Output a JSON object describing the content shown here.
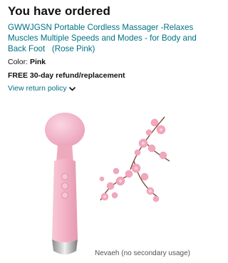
{
  "header": {
    "title": "You have ordered"
  },
  "product": {
    "name": "GWWJGSN Portable Cordless Massager -Relaxes Muscles Multiple Speeds and Modes - for Body and Back Foot   (Rose Pink)",
    "color_label": "Color:",
    "color_value": "Pink",
    "refund_text": "FREE 30-day refund/replacement",
    "return_policy_link": "View return policy",
    "return_policy_icon": "chevron-down-icon",
    "image": "pink-wand-massager-with-cherry-blossoms"
  },
  "caption": {
    "text": "Nevaeh (no secondary usage)"
  },
  "colors": {
    "link": "#007185",
    "text": "#0f1111",
    "product_pink": "#f5b9cb"
  }
}
